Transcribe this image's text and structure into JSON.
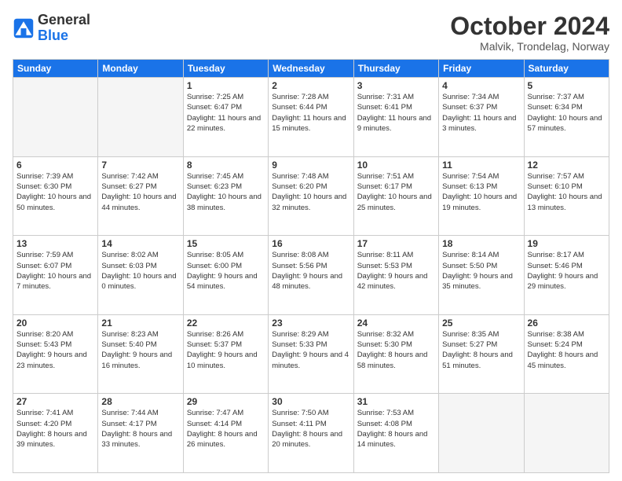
{
  "header": {
    "logo_general": "General",
    "logo_blue": "Blue",
    "month_title": "October 2024",
    "location": "Malvik, Trondelag, Norway"
  },
  "weekdays": [
    "Sunday",
    "Monday",
    "Tuesday",
    "Wednesday",
    "Thursday",
    "Friday",
    "Saturday"
  ],
  "weeks": [
    [
      {
        "day": "",
        "empty": true
      },
      {
        "day": "",
        "empty": true
      },
      {
        "day": "1",
        "sunrise": "Sunrise: 7:25 AM",
        "sunset": "Sunset: 6:47 PM",
        "daylight": "Daylight: 11 hours and 22 minutes."
      },
      {
        "day": "2",
        "sunrise": "Sunrise: 7:28 AM",
        "sunset": "Sunset: 6:44 PM",
        "daylight": "Daylight: 11 hours and 15 minutes."
      },
      {
        "day": "3",
        "sunrise": "Sunrise: 7:31 AM",
        "sunset": "Sunset: 6:41 PM",
        "daylight": "Daylight: 11 hours and 9 minutes."
      },
      {
        "day": "4",
        "sunrise": "Sunrise: 7:34 AM",
        "sunset": "Sunset: 6:37 PM",
        "daylight": "Daylight: 11 hours and 3 minutes."
      },
      {
        "day": "5",
        "sunrise": "Sunrise: 7:37 AM",
        "sunset": "Sunset: 6:34 PM",
        "daylight": "Daylight: 10 hours and 57 minutes."
      }
    ],
    [
      {
        "day": "6",
        "sunrise": "Sunrise: 7:39 AM",
        "sunset": "Sunset: 6:30 PM",
        "daylight": "Daylight: 10 hours and 50 minutes."
      },
      {
        "day": "7",
        "sunrise": "Sunrise: 7:42 AM",
        "sunset": "Sunset: 6:27 PM",
        "daylight": "Daylight: 10 hours and 44 minutes."
      },
      {
        "day": "8",
        "sunrise": "Sunrise: 7:45 AM",
        "sunset": "Sunset: 6:23 PM",
        "daylight": "Daylight: 10 hours and 38 minutes."
      },
      {
        "day": "9",
        "sunrise": "Sunrise: 7:48 AM",
        "sunset": "Sunset: 6:20 PM",
        "daylight": "Daylight: 10 hours and 32 minutes."
      },
      {
        "day": "10",
        "sunrise": "Sunrise: 7:51 AM",
        "sunset": "Sunset: 6:17 PM",
        "daylight": "Daylight: 10 hours and 25 minutes."
      },
      {
        "day": "11",
        "sunrise": "Sunrise: 7:54 AM",
        "sunset": "Sunset: 6:13 PM",
        "daylight": "Daylight: 10 hours and 19 minutes."
      },
      {
        "day": "12",
        "sunrise": "Sunrise: 7:57 AM",
        "sunset": "Sunset: 6:10 PM",
        "daylight": "Daylight: 10 hours and 13 minutes."
      }
    ],
    [
      {
        "day": "13",
        "sunrise": "Sunrise: 7:59 AM",
        "sunset": "Sunset: 6:07 PM",
        "daylight": "Daylight: 10 hours and 7 minutes."
      },
      {
        "day": "14",
        "sunrise": "Sunrise: 8:02 AM",
        "sunset": "Sunset: 6:03 PM",
        "daylight": "Daylight: 10 hours and 0 minutes."
      },
      {
        "day": "15",
        "sunrise": "Sunrise: 8:05 AM",
        "sunset": "Sunset: 6:00 PM",
        "daylight": "Daylight: 9 hours and 54 minutes."
      },
      {
        "day": "16",
        "sunrise": "Sunrise: 8:08 AM",
        "sunset": "Sunset: 5:56 PM",
        "daylight": "Daylight: 9 hours and 48 minutes."
      },
      {
        "day": "17",
        "sunrise": "Sunrise: 8:11 AM",
        "sunset": "Sunset: 5:53 PM",
        "daylight": "Daylight: 9 hours and 42 minutes."
      },
      {
        "day": "18",
        "sunrise": "Sunrise: 8:14 AM",
        "sunset": "Sunset: 5:50 PM",
        "daylight": "Daylight: 9 hours and 35 minutes."
      },
      {
        "day": "19",
        "sunrise": "Sunrise: 8:17 AM",
        "sunset": "Sunset: 5:46 PM",
        "daylight": "Daylight: 9 hours and 29 minutes."
      }
    ],
    [
      {
        "day": "20",
        "sunrise": "Sunrise: 8:20 AM",
        "sunset": "Sunset: 5:43 PM",
        "daylight": "Daylight: 9 hours and 23 minutes."
      },
      {
        "day": "21",
        "sunrise": "Sunrise: 8:23 AM",
        "sunset": "Sunset: 5:40 PM",
        "daylight": "Daylight: 9 hours and 16 minutes."
      },
      {
        "day": "22",
        "sunrise": "Sunrise: 8:26 AM",
        "sunset": "Sunset: 5:37 PM",
        "daylight": "Daylight: 9 hours and 10 minutes."
      },
      {
        "day": "23",
        "sunrise": "Sunrise: 8:29 AM",
        "sunset": "Sunset: 5:33 PM",
        "daylight": "Daylight: 9 hours and 4 minutes."
      },
      {
        "day": "24",
        "sunrise": "Sunrise: 8:32 AM",
        "sunset": "Sunset: 5:30 PM",
        "daylight": "Daylight: 8 hours and 58 minutes."
      },
      {
        "day": "25",
        "sunrise": "Sunrise: 8:35 AM",
        "sunset": "Sunset: 5:27 PM",
        "daylight": "Daylight: 8 hours and 51 minutes."
      },
      {
        "day": "26",
        "sunrise": "Sunrise: 8:38 AM",
        "sunset": "Sunset: 5:24 PM",
        "daylight": "Daylight: 8 hours and 45 minutes."
      }
    ],
    [
      {
        "day": "27",
        "sunrise": "Sunrise: 7:41 AM",
        "sunset": "Sunset: 4:20 PM",
        "daylight": "Daylight: 8 hours and 39 minutes."
      },
      {
        "day": "28",
        "sunrise": "Sunrise: 7:44 AM",
        "sunset": "Sunset: 4:17 PM",
        "daylight": "Daylight: 8 hours and 33 minutes."
      },
      {
        "day": "29",
        "sunrise": "Sunrise: 7:47 AM",
        "sunset": "Sunset: 4:14 PM",
        "daylight": "Daylight: 8 hours and 26 minutes."
      },
      {
        "day": "30",
        "sunrise": "Sunrise: 7:50 AM",
        "sunset": "Sunset: 4:11 PM",
        "daylight": "Daylight: 8 hours and 20 minutes."
      },
      {
        "day": "31",
        "sunrise": "Sunrise: 7:53 AM",
        "sunset": "Sunset: 4:08 PM",
        "daylight": "Daylight: 8 hours and 14 minutes."
      },
      {
        "day": "",
        "empty": true
      },
      {
        "day": "",
        "empty": true
      }
    ]
  ]
}
